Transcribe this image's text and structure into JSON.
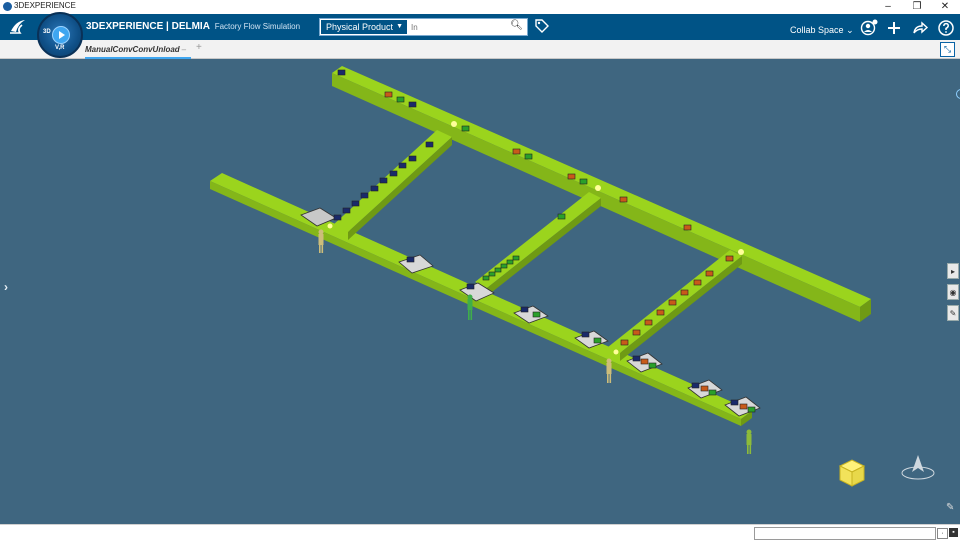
{
  "window": {
    "title": "3DEXPERIENCE",
    "minimize": "–",
    "restore": "❐",
    "close": "✕"
  },
  "compass": {
    "label_3d": "3D",
    "label_v": "V,R"
  },
  "header": {
    "brand_bold": "3DEXPERIENCE | DELMIA",
    "app_name": "Factory Flow Simulation",
    "collab_space": "Collab Space"
  },
  "search": {
    "scope": "Physical Product",
    "placeholder": "In"
  },
  "tabs": [
    {
      "label": "ManualConvConvUnload"
    }
  ],
  "icons": {
    "ds_logo": "dassault-logo",
    "tag": "tag-icon",
    "user": "user-icon",
    "add": "plus-icon",
    "share": "share-icon",
    "help": "help-icon"
  },
  "colors": {
    "topbar": "#005386",
    "viewport": "#3f6680",
    "conveyor_top": "#9bd41d",
    "conveyor_side": "#6f9a14",
    "conveyor_front": "#84b619",
    "accent": "#3fa6f0"
  }
}
